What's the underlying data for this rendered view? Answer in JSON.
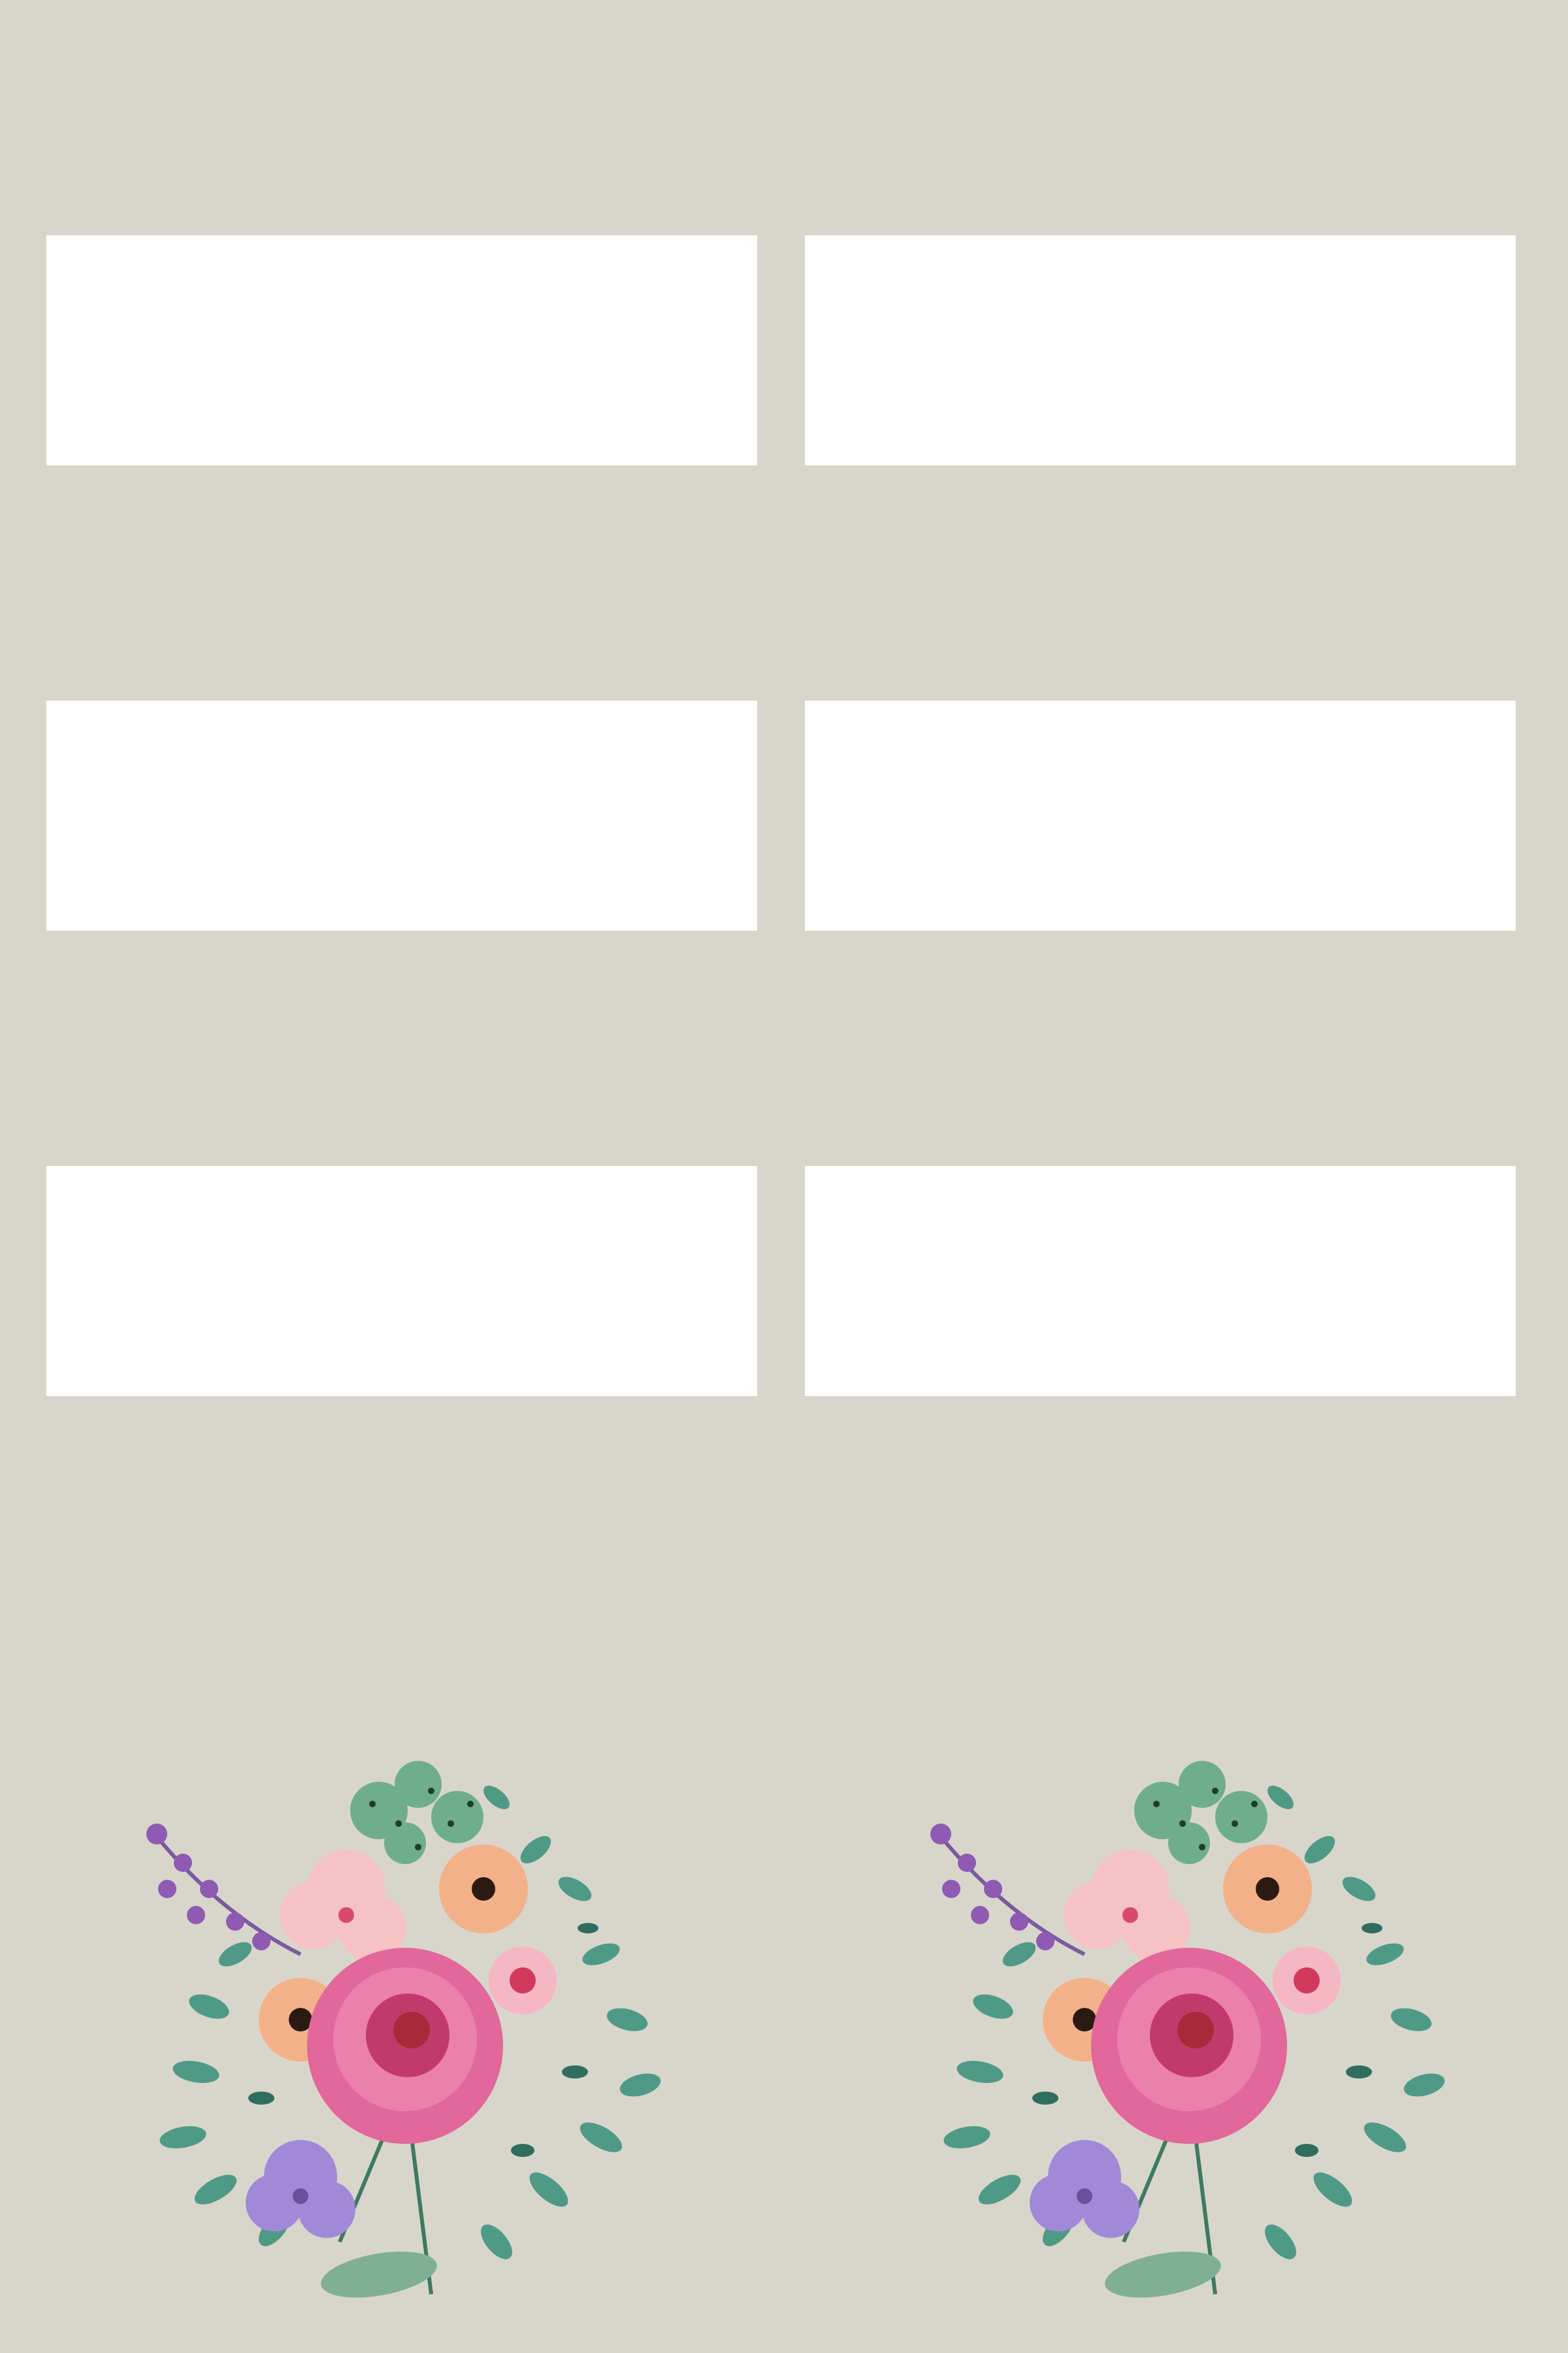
{
  "page": {
    "background_color": "#d8d6cb"
  },
  "cards": [
    {
      "id": "card-1",
      "text": ""
    },
    {
      "id": "card-2",
      "text": ""
    },
    {
      "id": "card-3",
      "text": ""
    },
    {
      "id": "card-4",
      "text": ""
    },
    {
      "id": "card-5",
      "text": ""
    },
    {
      "id": "card-6",
      "text": ""
    }
  ],
  "decorations": {
    "bouquet_left": {
      "icon": "floral-bouquet-icon"
    },
    "bouquet_right": {
      "icon": "floral-bouquet-icon"
    }
  },
  "colors": {
    "rose_pink": "#e2679b",
    "rose_center": "#c23a6b",
    "peach": "#f3b18a",
    "blush": "#f6c3c4",
    "purple_berry": "#8e5ab3",
    "lavender": "#a08ad8",
    "leaf_teal": "#4f9a86",
    "leaf_dark": "#2f6e5e"
  }
}
